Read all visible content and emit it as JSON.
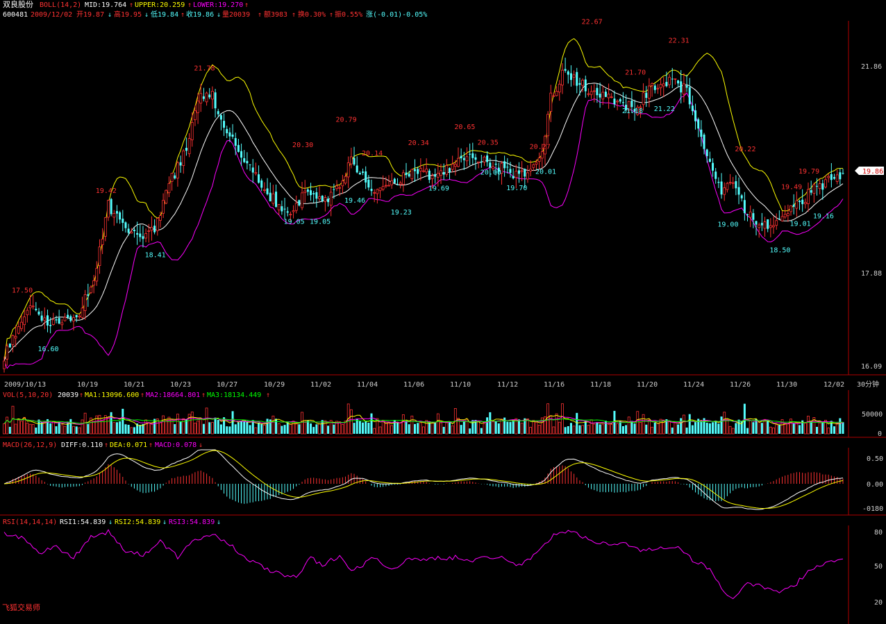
{
  "header": {
    "stock_name": "双良股份",
    "boll_label": "BOLL(14,2)",
    "boll_mid": "MID:19.764",
    "boll_upper": "UPPER:20.259",
    "boll_lower": "LOWER:19.270",
    "code": "600481",
    "date": "2009/12/02",
    "open": "开19.87",
    "high": "高19.95",
    "low": "低19.84",
    "close": "收19.86",
    "volume": "量20039",
    "amount": "额3983",
    "turnover": "换0.30%",
    "amplitude": "振0.55%",
    "change": "涨(-0.01)-0.05%"
  },
  "main_axis": {
    "ticks": [
      "21.86",
      "17.88",
      "16.09"
    ],
    "current_price": "19.86"
  },
  "x_axis": {
    "labels": [
      "2009/10/13",
      "10/19",
      "10/21",
      "10/23",
      "10/27",
      "10/29",
      "11/02",
      "11/04",
      "11/06",
      "11/10",
      "11/12",
      "11/16",
      "11/18",
      "11/20",
      "11/24",
      "11/26",
      "11/30",
      "12/02"
    ],
    "period": "30分钟"
  },
  "vol_panel": {
    "label": "VOL(5,10,20)",
    "value": "20039",
    "ma1": "MA1:13096.600",
    "ma2": "MA2:18664.801",
    "ma3": "MA3:18134.449",
    "ticks": [
      "50000",
      "0"
    ]
  },
  "macd_panel": {
    "label": "MACD(26,12,9)",
    "diff": "DIFF:0.110",
    "dea": "DEA:0.071",
    "macd": "MACD:0.078",
    "ticks": [
      "0.50",
      "0.00",
      "-0180"
    ]
  },
  "rsi_panel": {
    "label": "RSI(14,14,14)",
    "rsi1": "RSI1:54.839",
    "rsi2": "RSI2:54.839",
    "rsi3": "RSI3:54.839",
    "ticks": [
      "80",
      "50",
      "20"
    ]
  },
  "footer": {
    "brand": "飞狐交易师"
  },
  "colors": {
    "up": "#ff3232",
    "down": "#54ffff",
    "mid": "#ffffff",
    "upper": "#ffff00",
    "lower": "#ff00ff",
    "axis": "#b00000",
    "dea": "#ffff00",
    "ma3": "#00ff00"
  },
  "chart_data": {
    "type": "candlestick",
    "price_knots": [
      [
        0,
        16.35
      ],
      [
        8,
        17.3
      ],
      [
        15,
        16.95
      ],
      [
        22,
        17.05
      ],
      [
        26,
        17.15
      ],
      [
        32,
        18.05
      ],
      [
        36,
        19.25
      ],
      [
        40,
        19.0
      ],
      [
        46,
        18.65
      ],
      [
        52,
        18.75
      ],
      [
        56,
        19.55
      ],
      [
        62,
        20.2
      ],
      [
        68,
        21.35
      ],
      [
        72,
        21.35
      ],
      [
        78,
        20.6
      ],
      [
        84,
        20.05
      ],
      [
        90,
        19.55
      ],
      [
        96,
        19.2
      ],
      [
        100,
        19.1
      ],
      [
        104,
        19.6
      ],
      [
        108,
        19.3
      ],
      [
        112,
        19.4
      ],
      [
        116,
        19.6
      ],
      [
        120,
        20.1
      ],
      [
        124,
        19.85
      ],
      [
        128,
        19.55
      ],
      [
        136,
        19.7
      ],
      [
        142,
        19.9
      ],
      [
        150,
        19.8
      ],
      [
        156,
        20.05
      ],
      [
        162,
        20.25
      ],
      [
        168,
        20.05
      ],
      [
        174,
        19.9
      ],
      [
        180,
        19.8
      ],
      [
        186,
        20.2
      ],
      [
        189,
        21.3
      ],
      [
        194,
        21.85
      ],
      [
        200,
        21.55
      ],
      [
        206,
        21.35
      ],
      [
        212,
        21.25
      ],
      [
        218,
        21.1
      ],
      [
        224,
        21.55
      ],
      [
        230,
        21.65
      ],
      [
        236,
        21.45
      ],
      [
        242,
        20.4
      ],
      [
        248,
        19.5
      ],
      [
        252,
        19.7
      ],
      [
        256,
        19.2
      ],
      [
        262,
        18.85
      ],
      [
        268,
        19.0
      ],
      [
        274,
        19.25
      ],
      [
        280,
        19.55
      ],
      [
        286,
        19.75
      ],
      [
        290,
        19.86
      ]
    ],
    "annotations": [
      {
        "label": "17.50",
        "i": 6,
        "kind": "high"
      },
      {
        "label": "16.60",
        "i": 15,
        "kind": "low"
      },
      {
        "label": "19.42",
        "i": 35,
        "kind": "high"
      },
      {
        "label": "18.41",
        "i": 52,
        "kind": "low"
      },
      {
        "label": "21.78",
        "i": 69,
        "kind": "high"
      },
      {
        "label": "19.05",
        "i": 100,
        "kind": "low"
      },
      {
        "label": "20.30",
        "i": 103,
        "kind": "high"
      },
      {
        "label": "19.05",
        "i": 109,
        "kind": "low"
      },
      {
        "label": "20.79",
        "i": 118,
        "kind": "high"
      },
      {
        "label": "19.46",
        "i": 121,
        "kind": "low"
      },
      {
        "label": "20.14",
        "i": 127,
        "kind": "high"
      },
      {
        "label": "19.23",
        "i": 137,
        "kind": "low"
      },
      {
        "label": "20.34",
        "i": 143,
        "kind": "high"
      },
      {
        "label": "19.69",
        "i": 150,
        "kind": "low"
      },
      {
        "label": "20.65",
        "i": 159,
        "kind": "high"
      },
      {
        "label": "20.35",
        "i": 167,
        "kind": "high"
      },
      {
        "label": "20.00",
        "i": 168,
        "kind": "low"
      },
      {
        "label": "19.70",
        "i": 177,
        "kind": "low"
      },
      {
        "label": "20.27",
        "i": 185,
        "kind": "high"
      },
      {
        "label": "20.01",
        "i": 187,
        "kind": "low"
      },
      {
        "label": "22.67",
        "i": 203,
        "kind": "high"
      },
      {
        "label": "21.70",
        "i": 218,
        "kind": "high"
      },
      {
        "label": "21.18",
        "i": 217,
        "kind": "low"
      },
      {
        "label": "21.22",
        "i": 228,
        "kind": "low"
      },
      {
        "label": "22.31",
        "i": 233,
        "kind": "high"
      },
      {
        "label": "20.22",
        "i": 256,
        "kind": "high"
      },
      {
        "label": "19.00",
        "i": 250,
        "kind": "low"
      },
      {
        "label": "18.50",
        "i": 268,
        "kind": "low"
      },
      {
        "label": "19.49",
        "i": 272,
        "kind": "high"
      },
      {
        "label": "19.01",
        "i": 275,
        "kind": "low"
      },
      {
        "label": "19.79",
        "i": 278,
        "kind": "high"
      },
      {
        "label": "19.16",
        "i": 283,
        "kind": "low"
      }
    ],
    "rsi_knots": [
      [
        0,
        79
      ],
      [
        6,
        75
      ],
      [
        12,
        62
      ],
      [
        18,
        67
      ],
      [
        24,
        58
      ],
      [
        30,
        76
      ],
      [
        36,
        80
      ],
      [
        42,
        63
      ],
      [
        48,
        60
      ],
      [
        54,
        72
      ],
      [
        60,
        58
      ],
      [
        66,
        73
      ],
      [
        72,
        79
      ],
      [
        78,
        69
      ],
      [
        84,
        56
      ],
      [
        90,
        49
      ],
      [
        96,
        43
      ],
      [
        102,
        42
      ],
      [
        106,
        58
      ],
      [
        110,
        51
      ],
      [
        116,
        60
      ],
      [
        120,
        46
      ],
      [
        128,
        58
      ],
      [
        134,
        48
      ],
      [
        140,
        56
      ],
      [
        148,
        57
      ],
      [
        156,
        58
      ],
      [
        162,
        56
      ],
      [
        170,
        59
      ],
      [
        178,
        52
      ],
      [
        184,
        60
      ],
      [
        190,
        78
      ],
      [
        196,
        80
      ],
      [
        202,
        74
      ],
      [
        208,
        69
      ],
      [
        214,
        71
      ],
      [
        220,
        64
      ],
      [
        226,
        66
      ],
      [
        232,
        68
      ],
      [
        238,
        56
      ],
      [
        244,
        48
      ],
      [
        248,
        32
      ],
      [
        252,
        22
      ],
      [
        256,
        35
      ],
      [
        262,
        33
      ],
      [
        268,
        27
      ],
      [
        274,
        36
      ],
      [
        280,
        50
      ],
      [
        286,
        56
      ],
      [
        290,
        55
      ]
    ],
    "ylim_price": [
      16.09,
      22.8
    ]
  }
}
